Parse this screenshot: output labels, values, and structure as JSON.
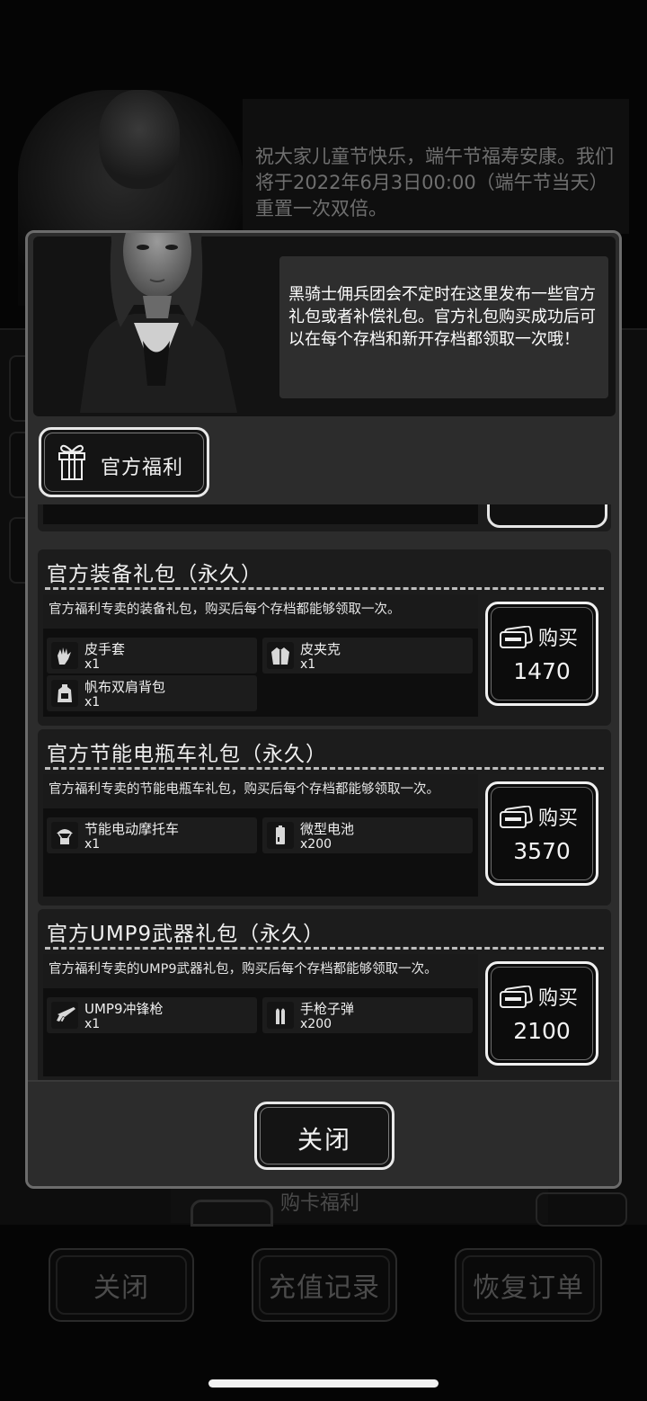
{
  "background": {
    "notice_text": "祝大家儿童节快乐，端午节福寿安康。我们将于2022年6月3日00:00（端午节当天）重置一次双倍。",
    "card_label": "购卡福利",
    "buttons": [
      "关闭",
      "充值记录",
      "恢复订单"
    ]
  },
  "dialog": {
    "speech": "黑骑士佣兵团会不定时在这里发布一些官方礼包或者补偿礼包。官方礼包购买成功后可以在每个存档和新开存档都领取一次哦！",
    "tab_label": "官方福利",
    "buy_label": "购买",
    "packs": [
      {
        "title": "官方装备礼包（永久）",
        "desc": "官方福利专卖的装备礼包，购买后每个存档都能够领取一次。",
        "price": "1470",
        "items": [
          {
            "name": "皮手套",
            "qty": "x1",
            "icon": "glove-icon"
          },
          {
            "name": "皮夹克",
            "qty": "x1",
            "icon": "jacket-icon"
          },
          {
            "name": "帆布双肩背包",
            "qty": "x1",
            "icon": "backpack-icon"
          }
        ]
      },
      {
        "title": "官方节能电瓶车礼包（永久）",
        "desc": "官方福利专卖的节能电瓶车礼包，购买后每个存档都能够领取一次。",
        "price": "3570",
        "items": [
          {
            "name": "节能电动摩托车",
            "qty": "x1",
            "icon": "scooter-icon"
          },
          {
            "name": "微型电池",
            "qty": "x200",
            "icon": "battery-icon"
          }
        ]
      },
      {
        "title": "官方UMP9武器礼包（永久）",
        "desc": "官方福利专卖的UMP9武器礼包，购买后每个存档都能够领取一次。",
        "price": "2100",
        "items": [
          {
            "name": "UMP9冲锋枪",
            "qty": "x1",
            "icon": "smg-icon"
          },
          {
            "name": "手枪子弹",
            "qty": "x200",
            "icon": "bullets-icon"
          }
        ]
      }
    ],
    "close_label": "关闭"
  }
}
